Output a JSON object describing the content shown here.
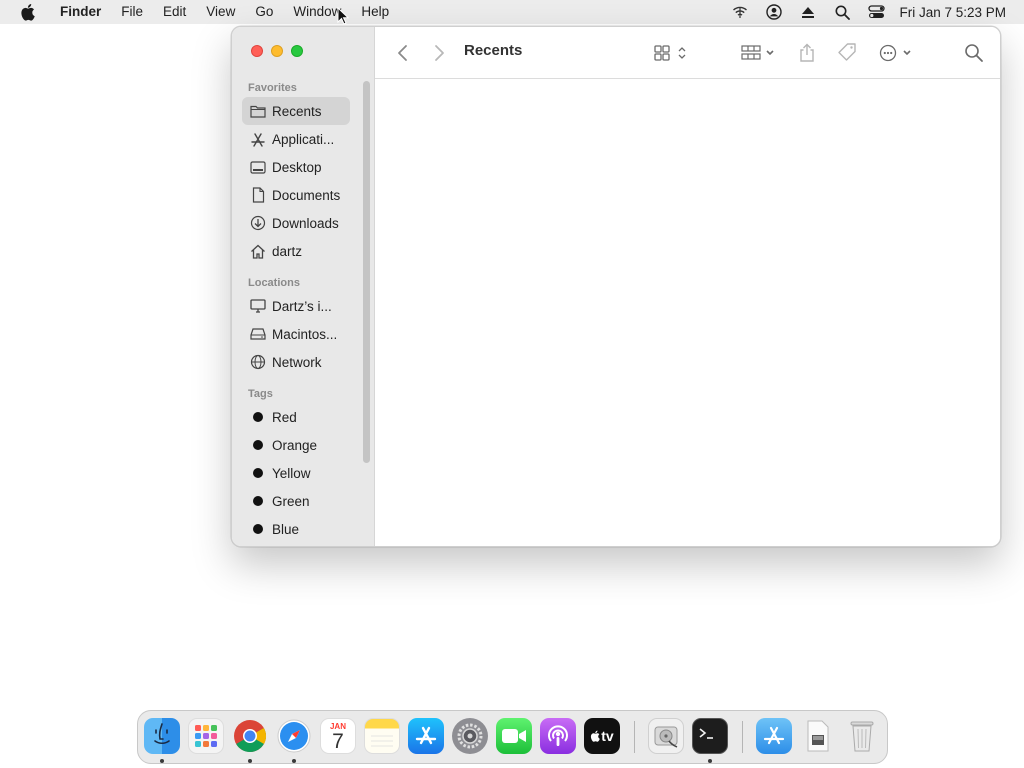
{
  "menubar": {
    "apple_icon": "apple-logo-icon",
    "app_name": "Finder",
    "menus": [
      "File",
      "Edit",
      "View",
      "Go",
      "Window",
      "Help"
    ],
    "status_icons": [
      "wifi-icon",
      "user-account-icon",
      "eject-icon",
      "spotlight-search-icon",
      "control-center-icon"
    ],
    "clock": "Fri Jan 7  5:23 PM"
  },
  "window": {
    "title": "Recents",
    "toolbar": {
      "back_icon": "chevron-left-icon",
      "forward_icon": "chevron-right-icon",
      "view_icon": "grid-view-icon",
      "group_icon": "group-by-icon",
      "share_icon": "share-icon",
      "tag_icon": "tag-icon",
      "more_icon": "ellipsis-circle-icon",
      "search_icon": "search-icon"
    },
    "sidebar": {
      "favorites_title": "Favorites",
      "favorites": [
        {
          "label": "Recents",
          "icon": "folder-clock-icon"
        },
        {
          "label": "Applicati...",
          "icon": "applications-icon"
        },
        {
          "label": "Desktop",
          "icon": "desktop-icon"
        },
        {
          "label": "Documents",
          "icon": "document-icon"
        },
        {
          "label": "Downloads",
          "icon": "download-icon"
        },
        {
          "label": "dartz",
          "icon": "home-icon"
        }
      ],
      "locations_title": "Locations",
      "locations": [
        {
          "label": "Dartz’s i...",
          "icon": "computer-icon"
        },
        {
          "label": "Macintos...",
          "icon": "hard-drive-icon"
        },
        {
          "label": "Network",
          "icon": "network-globe-icon"
        }
      ],
      "tags_title": "Tags",
      "tags": [
        {
          "label": "Red"
        },
        {
          "label": "Orange"
        },
        {
          "label": "Yellow"
        },
        {
          "label": "Green"
        },
        {
          "label": "Blue"
        }
      ]
    }
  },
  "dock": {
    "apps": [
      {
        "name": "finder-icon",
        "running": true
      },
      {
        "name": "launchpad-icon",
        "running": false
      },
      {
        "name": "chrome-icon",
        "running": true
      },
      {
        "name": "safari-icon",
        "running": true
      },
      {
        "name": "calendar-icon",
        "running": false,
        "month": "JAN",
        "day": "7"
      },
      {
        "name": "notes-icon",
        "running": false
      },
      {
        "name": "app-store-icon",
        "running": false
      },
      {
        "name": "system-settings-icon",
        "running": false
      },
      {
        "name": "facetime-icon",
        "running": false
      },
      {
        "name": "podcasts-icon",
        "running": false
      },
      {
        "name": "apple-tv-icon",
        "running": false,
        "label": "tv"
      },
      {
        "name": "disk-utility-icon",
        "running": false
      },
      {
        "name": "terminal-icon",
        "running": true
      },
      {
        "name": "applications-folder-icon",
        "running": false
      },
      {
        "name": "document-stack-icon",
        "running": false
      },
      {
        "name": "trash-icon",
        "running": false
      }
    ]
  }
}
